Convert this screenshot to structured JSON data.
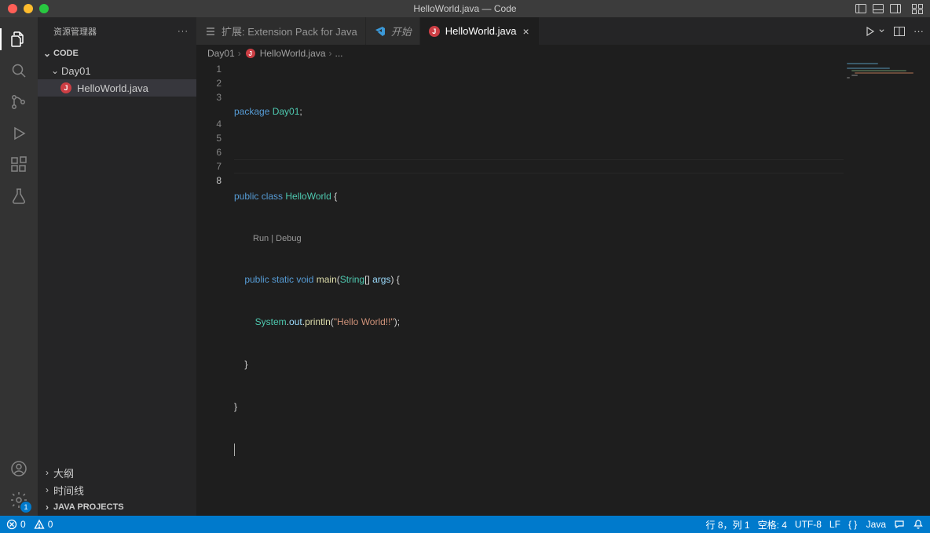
{
  "titlebar": {
    "title": "HelloWorld.java — Code"
  },
  "sidebar": {
    "title": "资源管理器",
    "project": "CODE",
    "folder": "Day01",
    "file": "HelloWorld.java",
    "outline": "大纲",
    "timeline": "时间线",
    "javaProjects": "JAVA PROJECTS"
  },
  "activity": {
    "settings_badge": "1"
  },
  "tabs": {
    "ext": "扩展: Extension Pack for Java",
    "start": "开始",
    "file": "HelloWorld.java"
  },
  "breadcrumbs": {
    "folder": "Day01",
    "file": "HelloWorld.java",
    "more": "..."
  },
  "codelens": {
    "text": "Run | Debug"
  },
  "code": {
    "l1_package": "package",
    "l1_pkgname": " Day01",
    "l1_semi": ";",
    "l3_public": "public",
    "l3_class": " class",
    "l3_name": " HelloWorld",
    "l3_brace": " {",
    "l4_public": "    public",
    "l4_static": " static",
    "l4_void": " void",
    "l4_main": " main",
    "l4_paren1": "(",
    "l4_type": "String",
    "l4_arr": "[] ",
    "l4_arg": "args",
    "l4_paren2": ") {",
    "l5_indent": "        ",
    "l5_system": "System",
    "l5_dot1": ".",
    "l5_out": "out",
    "l5_dot2": ".",
    "l5_println": "println",
    "l5_paren1": "(",
    "l5_str": "\"Hello World!!\"",
    "l5_paren2": ");",
    "l6": "    }",
    "l7": "}"
  },
  "line_numbers": [
    "1",
    "2",
    "3",
    "4",
    "5",
    "6",
    "7",
    "8"
  ],
  "status": {
    "errors": "0",
    "warnings": "0",
    "lncol": "行 8，列 1",
    "spaces": "空格: 4",
    "encoding": "UTF-8",
    "eol": "LF",
    "lang_braces": "{ }",
    "lang": "Java"
  }
}
